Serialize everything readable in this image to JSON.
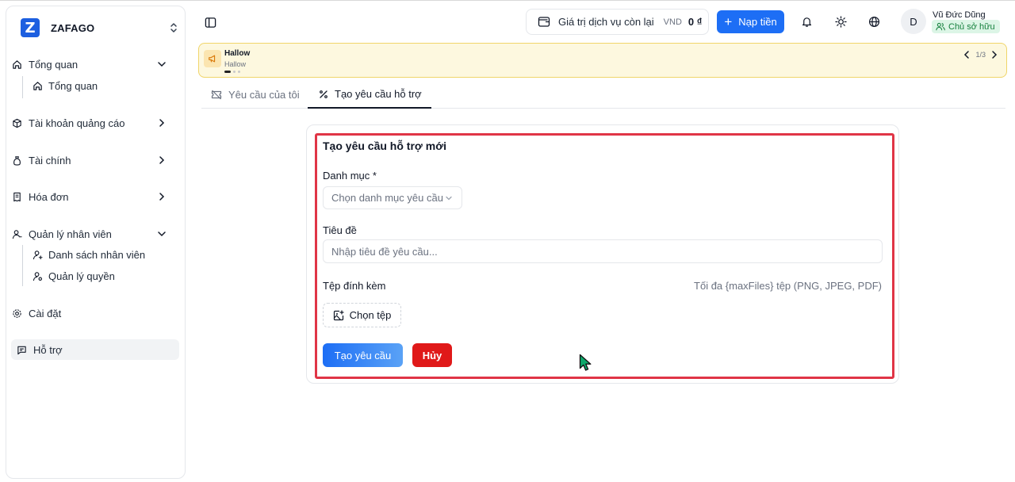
{
  "brand": {
    "name": "ZAFAGO",
    "logo_letter": "Z"
  },
  "sidebar": {
    "groups": [
      {
        "label": "Tổng quan",
        "icon": "home-icon",
        "expanded": true,
        "children": [
          {
            "label": "Tổng quan",
            "icon": "home-icon"
          }
        ]
      },
      {
        "label": "Tài khoản quảng cáo",
        "icon": "box-icon",
        "expanded": false
      },
      {
        "label": "Tài chính",
        "icon": "money-bag-icon",
        "expanded": false
      },
      {
        "label": "Hóa đơn",
        "icon": "receipt-icon",
        "expanded": false
      },
      {
        "label": "Quản lý nhân viên",
        "icon": "user-icon",
        "expanded": true,
        "children": [
          {
            "label": "Danh sách nhân viên",
            "icon": "user-plus-icon"
          },
          {
            "label": "Quản lý quyền",
            "icon": "user-key-icon"
          }
        ]
      },
      {
        "label": "Cài đặt",
        "icon": "gear-icon",
        "expanded": false
      },
      {
        "label": "Hỗ trợ",
        "icon": "message-icon",
        "active": true
      }
    ]
  },
  "header": {
    "balance_label": "Giá trị dịch vụ còn lại",
    "currency": "VND",
    "balance_amount": "0 ₫",
    "topup_label": "Nạp tiền",
    "user": {
      "initial": "D",
      "name": "Vũ Đức Dũng",
      "role": "Chủ sở hữu"
    }
  },
  "announcement": {
    "title": "Hallow",
    "subtitle": "Hallow",
    "pager": "1/3"
  },
  "tabs": [
    {
      "label": "Yêu cầu của tôi",
      "icon": "ticket-off-icon",
      "active": false
    },
    {
      "label": "Tạo yêu cầu hỗ trợ",
      "icon": "percent-icon",
      "active": true
    }
  ],
  "form": {
    "title": "Tạo yêu cầu hỗ trợ mới",
    "category_label": "Danh mục *",
    "category_placeholder": "Chọn danh mục yêu cầu",
    "subject_label": "Tiêu đề",
    "subject_placeholder": "Nhập tiêu đề yêu cầu...",
    "subject_value": "",
    "attachment_label": "Tệp đính kèm",
    "attachment_hint": "Tối đa {maxFiles} tệp (PNG, JPEG, PDF)",
    "choose_file_label": "Chọn tệp",
    "submit_label": "Tạo yêu cầu",
    "cancel_label": "Hủy"
  },
  "colors": {
    "primary": "#1d6ef5",
    "danger": "#e01919",
    "highlight": "#e03546",
    "announcement_bg": "#fdf8df",
    "role_badge_bg": "#dcf5e6"
  }
}
